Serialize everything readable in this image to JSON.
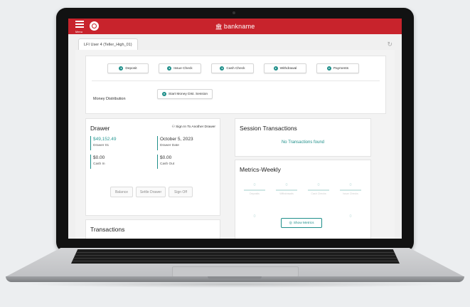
{
  "topbar": {
    "menu_label": "Menu",
    "brand": "bankname",
    "colors": {
      "bar": "#c8232c",
      "accent": "#1f8f8a"
    }
  },
  "tabs": [
    {
      "label": "LFI User 4 (Teller_High_01)"
    }
  ],
  "actions": [
    {
      "label": "Deposit",
      "icon": "deposit-icon"
    },
    {
      "label": "Issue Check",
      "icon": "issue-check-icon"
    },
    {
      "label": "Cash Check",
      "icon": "cash-check-icon"
    },
    {
      "label": "Withdrawal",
      "icon": "withdrawal-icon"
    },
    {
      "label": "Payments",
      "icon": "payments-icon"
    }
  ],
  "money_distribution": {
    "label": "Money Distribution",
    "button": "Start Money Dist. Session"
  },
  "drawer": {
    "title": "Drawer",
    "sign_in_link": "Sign In To Another Drawer",
    "amount": "$49,152.49",
    "drawer_id": "Drawer 01",
    "date": "October 5, 2023",
    "date_label": "Drawer Date",
    "cash_in_value": "$0.00",
    "cash_in_label": "Cash In",
    "cash_out_value": "$0.00",
    "cash_out_label": "Cash Out",
    "buttons": {
      "balance": "Balance",
      "settle": "Settle Drawer",
      "sign_off": "Sign Off"
    }
  },
  "transactions": {
    "title": "Transactions"
  },
  "session_transactions": {
    "title": "Session Transactions",
    "empty_text": "No Transactions found"
  },
  "metrics": {
    "title": "Metrics-Weekly",
    "items": [
      {
        "value": "0",
        "label": "Deposits"
      },
      {
        "value": "0",
        "label": "Withdrawals"
      },
      {
        "value": "0",
        "label": "Cash Checks"
      },
      {
        "value": "0",
        "label": "Issue Checks"
      },
      {
        "value": "0"
      },
      {
        "value": "0"
      }
    ],
    "show_button": "Show Metrics"
  }
}
